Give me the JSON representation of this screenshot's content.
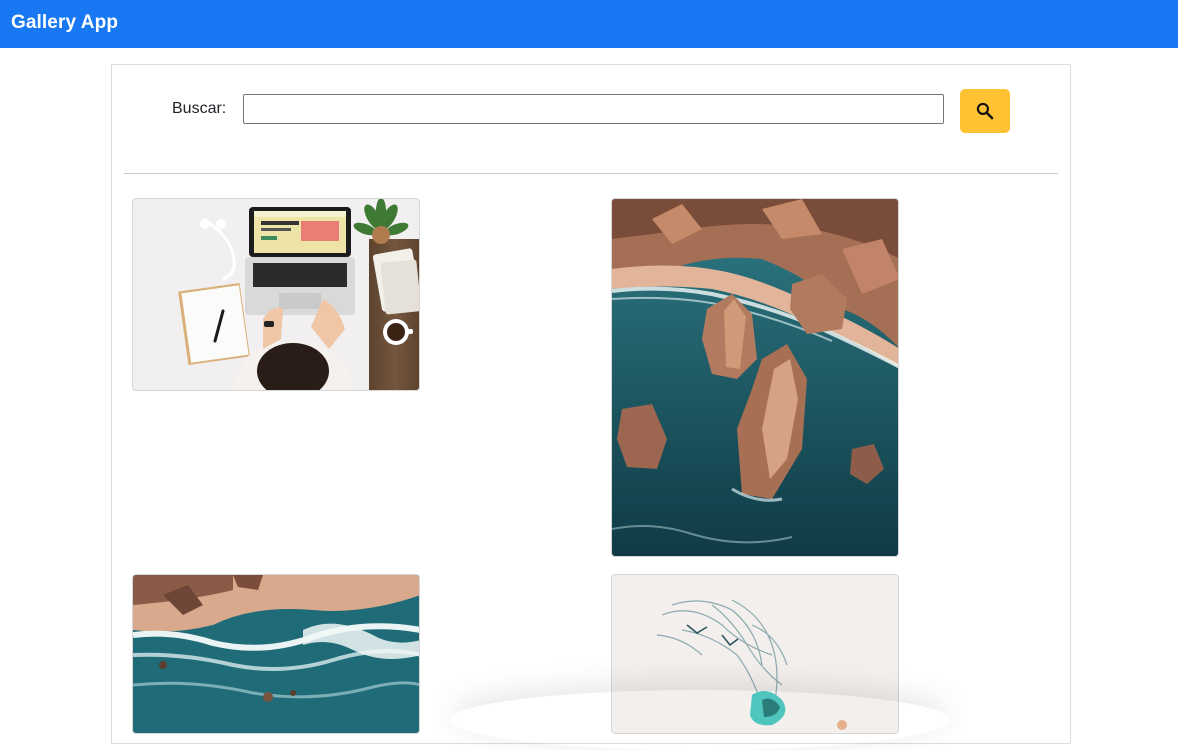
{
  "app": {
    "title": "Gallery App",
    "accent_color": "#1877f2"
  },
  "search": {
    "label": "Buscar:",
    "value": "",
    "placeholder": "",
    "button_icon": "search-icon",
    "button_color": "#ffc233"
  },
  "gallery": {
    "images": [
      {
        "subject": "laptop-desk-photo"
      },
      {
        "subject": "coastal-rocks-photo"
      },
      {
        "subject": "ocean-shore-photo"
      },
      {
        "subject": "abstract-paint-photo"
      }
    ]
  }
}
